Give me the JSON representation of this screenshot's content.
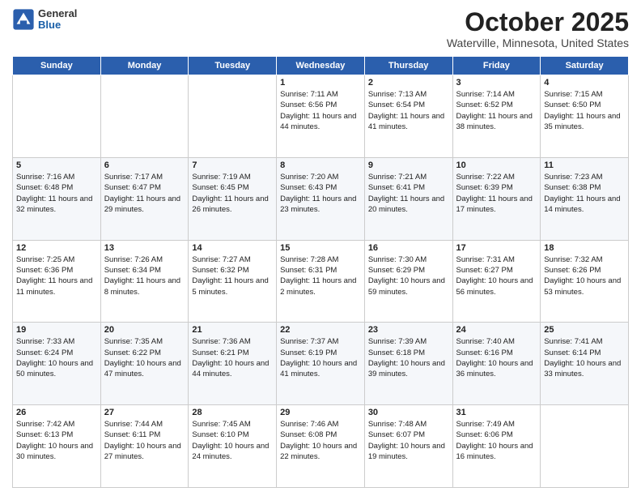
{
  "header": {
    "logo_general": "General",
    "logo_blue": "Blue",
    "month_title": "October 2025",
    "location": "Waterville, Minnesota, United States"
  },
  "days_of_week": [
    "Sunday",
    "Monday",
    "Tuesday",
    "Wednesday",
    "Thursday",
    "Friday",
    "Saturday"
  ],
  "weeks": [
    [
      {
        "day": "",
        "sunrise": "",
        "sunset": "",
        "daylight": ""
      },
      {
        "day": "",
        "sunrise": "",
        "sunset": "",
        "daylight": ""
      },
      {
        "day": "",
        "sunrise": "",
        "sunset": "",
        "daylight": ""
      },
      {
        "day": "1",
        "sunrise": "Sunrise: 7:11 AM",
        "sunset": "Sunset: 6:56 PM",
        "daylight": "Daylight: 11 hours and 44 minutes."
      },
      {
        "day": "2",
        "sunrise": "Sunrise: 7:13 AM",
        "sunset": "Sunset: 6:54 PM",
        "daylight": "Daylight: 11 hours and 41 minutes."
      },
      {
        "day": "3",
        "sunrise": "Sunrise: 7:14 AM",
        "sunset": "Sunset: 6:52 PM",
        "daylight": "Daylight: 11 hours and 38 minutes."
      },
      {
        "day": "4",
        "sunrise": "Sunrise: 7:15 AM",
        "sunset": "Sunset: 6:50 PM",
        "daylight": "Daylight: 11 hours and 35 minutes."
      }
    ],
    [
      {
        "day": "5",
        "sunrise": "Sunrise: 7:16 AM",
        "sunset": "Sunset: 6:48 PM",
        "daylight": "Daylight: 11 hours and 32 minutes."
      },
      {
        "day": "6",
        "sunrise": "Sunrise: 7:17 AM",
        "sunset": "Sunset: 6:47 PM",
        "daylight": "Daylight: 11 hours and 29 minutes."
      },
      {
        "day": "7",
        "sunrise": "Sunrise: 7:19 AM",
        "sunset": "Sunset: 6:45 PM",
        "daylight": "Daylight: 11 hours and 26 minutes."
      },
      {
        "day": "8",
        "sunrise": "Sunrise: 7:20 AM",
        "sunset": "Sunset: 6:43 PM",
        "daylight": "Daylight: 11 hours and 23 minutes."
      },
      {
        "day": "9",
        "sunrise": "Sunrise: 7:21 AM",
        "sunset": "Sunset: 6:41 PM",
        "daylight": "Daylight: 11 hours and 20 minutes."
      },
      {
        "day": "10",
        "sunrise": "Sunrise: 7:22 AM",
        "sunset": "Sunset: 6:39 PM",
        "daylight": "Daylight: 11 hours and 17 minutes."
      },
      {
        "day": "11",
        "sunrise": "Sunrise: 7:23 AM",
        "sunset": "Sunset: 6:38 PM",
        "daylight": "Daylight: 11 hours and 14 minutes."
      }
    ],
    [
      {
        "day": "12",
        "sunrise": "Sunrise: 7:25 AM",
        "sunset": "Sunset: 6:36 PM",
        "daylight": "Daylight: 11 hours and 11 minutes."
      },
      {
        "day": "13",
        "sunrise": "Sunrise: 7:26 AM",
        "sunset": "Sunset: 6:34 PM",
        "daylight": "Daylight: 11 hours and 8 minutes."
      },
      {
        "day": "14",
        "sunrise": "Sunrise: 7:27 AM",
        "sunset": "Sunset: 6:32 PM",
        "daylight": "Daylight: 11 hours and 5 minutes."
      },
      {
        "day": "15",
        "sunrise": "Sunrise: 7:28 AM",
        "sunset": "Sunset: 6:31 PM",
        "daylight": "Daylight: 11 hours and 2 minutes."
      },
      {
        "day": "16",
        "sunrise": "Sunrise: 7:30 AM",
        "sunset": "Sunset: 6:29 PM",
        "daylight": "Daylight: 10 hours and 59 minutes."
      },
      {
        "day": "17",
        "sunrise": "Sunrise: 7:31 AM",
        "sunset": "Sunset: 6:27 PM",
        "daylight": "Daylight: 10 hours and 56 minutes."
      },
      {
        "day": "18",
        "sunrise": "Sunrise: 7:32 AM",
        "sunset": "Sunset: 6:26 PM",
        "daylight": "Daylight: 10 hours and 53 minutes."
      }
    ],
    [
      {
        "day": "19",
        "sunrise": "Sunrise: 7:33 AM",
        "sunset": "Sunset: 6:24 PM",
        "daylight": "Daylight: 10 hours and 50 minutes."
      },
      {
        "day": "20",
        "sunrise": "Sunrise: 7:35 AM",
        "sunset": "Sunset: 6:22 PM",
        "daylight": "Daylight: 10 hours and 47 minutes."
      },
      {
        "day": "21",
        "sunrise": "Sunrise: 7:36 AM",
        "sunset": "Sunset: 6:21 PM",
        "daylight": "Daylight: 10 hours and 44 minutes."
      },
      {
        "day": "22",
        "sunrise": "Sunrise: 7:37 AM",
        "sunset": "Sunset: 6:19 PM",
        "daylight": "Daylight: 10 hours and 41 minutes."
      },
      {
        "day": "23",
        "sunrise": "Sunrise: 7:39 AM",
        "sunset": "Sunset: 6:18 PM",
        "daylight": "Daylight: 10 hours and 39 minutes."
      },
      {
        "day": "24",
        "sunrise": "Sunrise: 7:40 AM",
        "sunset": "Sunset: 6:16 PM",
        "daylight": "Daylight: 10 hours and 36 minutes."
      },
      {
        "day": "25",
        "sunrise": "Sunrise: 7:41 AM",
        "sunset": "Sunset: 6:14 PM",
        "daylight": "Daylight: 10 hours and 33 minutes."
      }
    ],
    [
      {
        "day": "26",
        "sunrise": "Sunrise: 7:42 AM",
        "sunset": "Sunset: 6:13 PM",
        "daylight": "Daylight: 10 hours and 30 minutes."
      },
      {
        "day": "27",
        "sunrise": "Sunrise: 7:44 AM",
        "sunset": "Sunset: 6:11 PM",
        "daylight": "Daylight: 10 hours and 27 minutes."
      },
      {
        "day": "28",
        "sunrise": "Sunrise: 7:45 AM",
        "sunset": "Sunset: 6:10 PM",
        "daylight": "Daylight: 10 hours and 24 minutes."
      },
      {
        "day": "29",
        "sunrise": "Sunrise: 7:46 AM",
        "sunset": "Sunset: 6:08 PM",
        "daylight": "Daylight: 10 hours and 22 minutes."
      },
      {
        "day": "30",
        "sunrise": "Sunrise: 7:48 AM",
        "sunset": "Sunset: 6:07 PM",
        "daylight": "Daylight: 10 hours and 19 minutes."
      },
      {
        "day": "31",
        "sunrise": "Sunrise: 7:49 AM",
        "sunset": "Sunset: 6:06 PM",
        "daylight": "Daylight: 10 hours and 16 minutes."
      },
      {
        "day": "",
        "sunrise": "",
        "sunset": "",
        "daylight": ""
      }
    ]
  ]
}
